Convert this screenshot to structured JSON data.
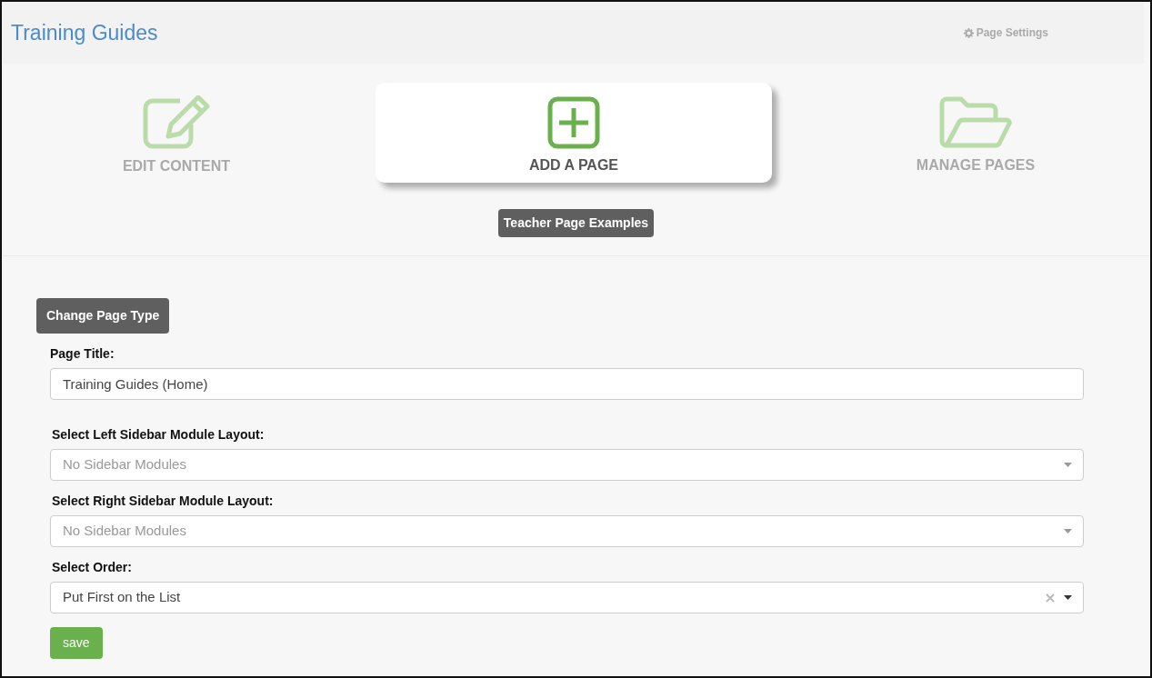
{
  "header": {
    "title": "Training Guides",
    "settings_link": "Page Settings"
  },
  "tabs": [
    {
      "label": "EDIT CONTENT",
      "kind": "edit",
      "selected": false
    },
    {
      "label": "ADD A PAGE",
      "kind": "add",
      "selected": true
    },
    {
      "label": "MANAGE PAGES",
      "kind": "folder",
      "selected": false
    }
  ],
  "examples_button": "Teacher Page Examples",
  "change_type_button": "Change Page Type",
  "fields": [
    {
      "kind": "text",
      "label": "Page Title:",
      "value": "Training Guides (Home)"
    },
    {
      "kind": "select",
      "label": "Select Left Sidebar Module Layout:",
      "placeholder": "No Sidebar Modules"
    },
    {
      "kind": "select",
      "label": "Select Right Sidebar Module Layout:",
      "placeholder": "No Sidebar Modules"
    },
    {
      "kind": "select",
      "label": "Select Order:",
      "value": "Put First on the List"
    }
  ],
  "save_button": "save"
}
